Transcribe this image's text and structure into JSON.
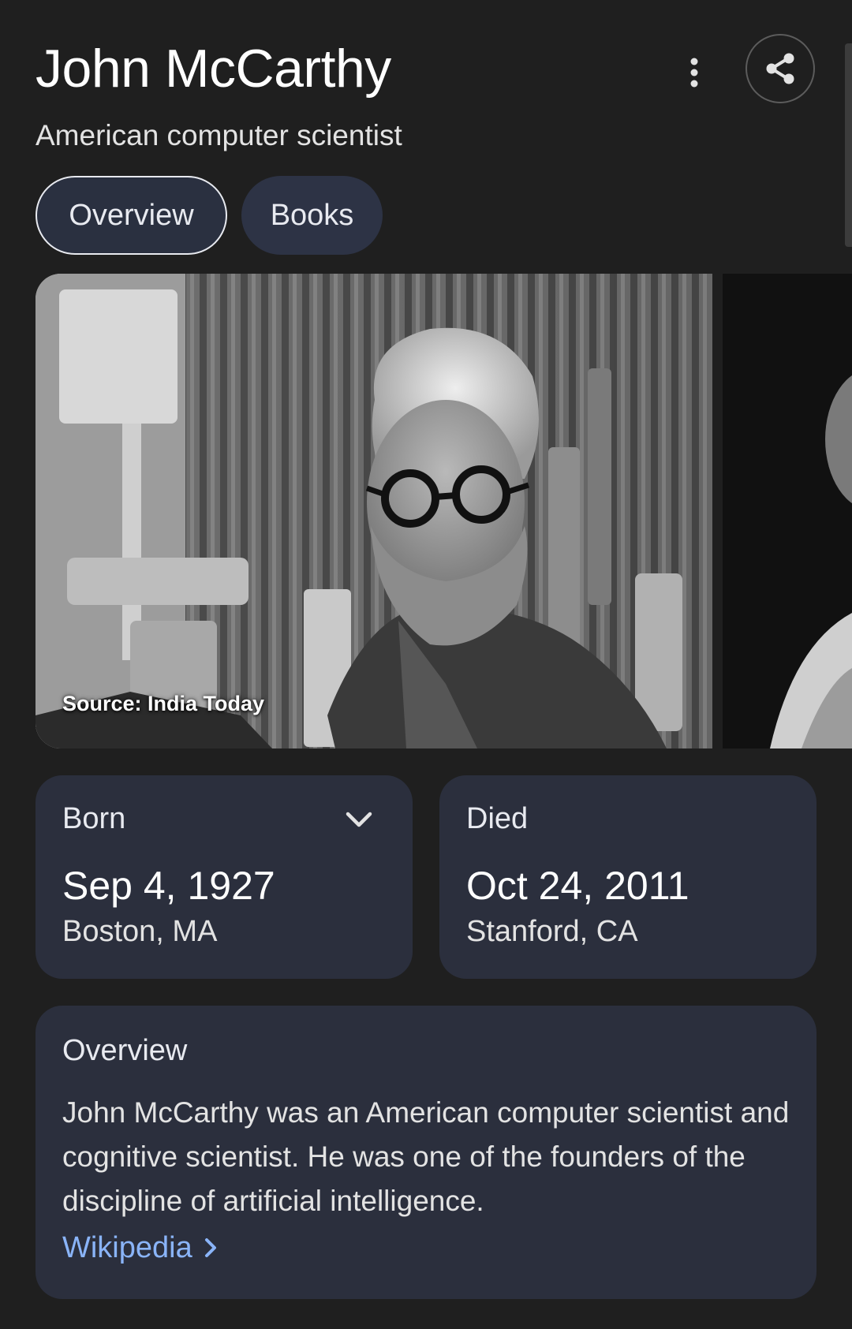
{
  "header": {
    "title": "John McCarthy",
    "subtitle": "American computer scientist"
  },
  "tabs": [
    {
      "label": "Overview",
      "selected": true
    },
    {
      "label": "Books",
      "selected": false
    }
  ],
  "images": {
    "caption": "Source: India Today"
  },
  "born": {
    "label": "Born",
    "date": "Sep 4, 1927",
    "place": "Boston, MA"
  },
  "died": {
    "label": "Died",
    "date": "Oct 24, 2011",
    "place": "Stanford, CA"
  },
  "overview": {
    "heading": "Overview",
    "text": "John McCarthy was an American computer scientist and cognitive scientist. He was one of the founders of the discipline of artificial intelligence.",
    "link_label": "Wikipedia"
  },
  "icons": {
    "more": "more-vertical-icon",
    "share": "share-icon",
    "expand": "chevron-down-icon",
    "link": "chevron-right-icon"
  },
  "colors": {
    "background": "#1f1f1f",
    "card": "#2b2f3d",
    "chip": "#2d3345",
    "link": "#8ab4f8"
  }
}
